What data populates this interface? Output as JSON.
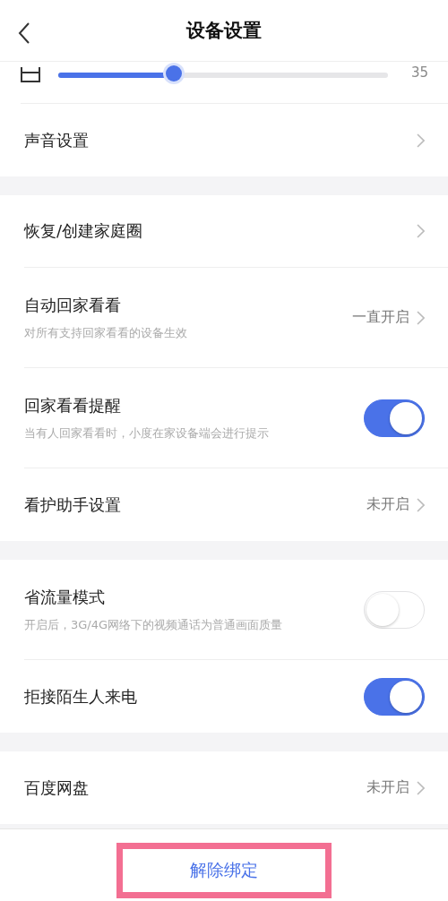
{
  "header": {
    "title": "设备设置"
  },
  "sections": [
    {
      "items": [
        {
          "kind": "slider",
          "level": 0.35,
          "reading": "35"
        },
        {
          "kind": "link",
          "title": "声音设置"
        }
      ]
    },
    {
      "items": [
        {
          "kind": "link",
          "title": "恢复/创建家庭圈"
        },
        {
          "kind": "link",
          "title": "自动回家看看",
          "subtitle": "对所有支持回家看看的设备生效",
          "value": "一直开启"
        },
        {
          "kind": "toggle",
          "title": "回家看看提醒",
          "subtitle": "当有人回家看看时，小度在家设备端会进行提示",
          "on": true
        },
        {
          "kind": "link",
          "title": "看护助手设置",
          "value": "未开启"
        }
      ]
    },
    {
      "items": [
        {
          "kind": "toggle",
          "title": "省流量模式",
          "subtitle": "开启后，3G/4G网络下的视频通话为普通画面质量",
          "on": false
        },
        {
          "kind": "toggle",
          "title": "拒接陌生人来电",
          "on": true
        }
      ]
    },
    {
      "items": [
        {
          "kind": "link",
          "title": "百度网盘",
          "value": "未开启"
        }
      ]
    }
  ],
  "footer": {
    "button": "解除绑定",
    "highlighted": true
  }
}
